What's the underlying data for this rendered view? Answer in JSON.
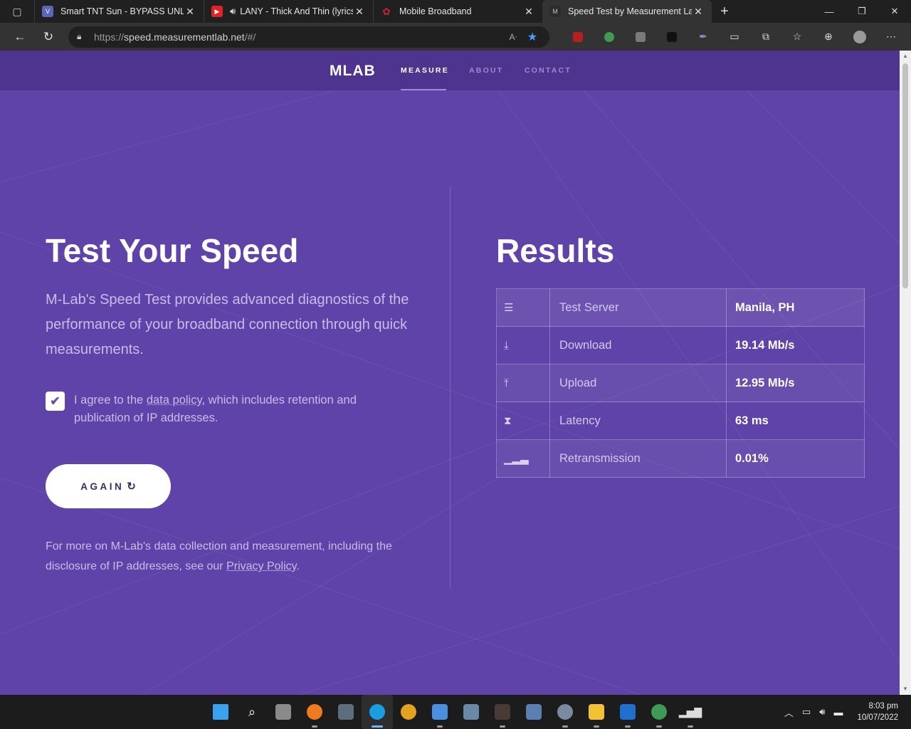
{
  "browser": {
    "tabs": [
      {
        "title": "Smart TNT Sun - BYPASS UNLIDATA",
        "fav": "V",
        "fav_color": "#5a66b8",
        "active": false,
        "muted_icon": false
      },
      {
        "title": "LANY - Thick And Thin (lyrics)",
        "fav": "▶",
        "fav_color": "#e02424",
        "active": false,
        "muted_icon": true
      },
      {
        "title": "Mobile Broadband",
        "fav": "✿",
        "fav_color": "#c0262d",
        "active": false,
        "muted_icon": false
      },
      {
        "title": "Speed Test by Measurement Lab",
        "fav": "M",
        "fav_color": "#2c2c2c",
        "active": true,
        "muted_icon": false
      }
    ],
    "url_scheme": "https://",
    "url_host": "speed.measurementlab.net",
    "url_path": "/#/"
  },
  "site": {
    "logo": "MLAB",
    "nav": [
      {
        "label": "MEASURE",
        "active": true
      },
      {
        "label": "ABOUT",
        "active": false
      },
      {
        "label": "CONTACT",
        "active": false
      }
    ]
  },
  "test": {
    "title": "Test Your Speed",
    "description": "M-Lab's Speed Test provides advanced diagnostics of the performance of your broadband connection through quick measurements.",
    "agree_prefix": "I agree to the ",
    "agree_link": "data policy",
    "agree_suffix": ", which includes retention and publication of IP addresses.",
    "agree_checked": true,
    "again_label": "AGAIN",
    "footnote_prefix": "For more on M-Lab's data collection and measurement, including the disclosure of IP addresses, see our ",
    "footnote_link": "Privacy Policy",
    "footnote_suffix": "."
  },
  "results": {
    "title": "Results",
    "rows": [
      {
        "icon": "server-icon",
        "label": "Test Server",
        "value": "Manila, PH"
      },
      {
        "icon": "download-icon",
        "label": "Download",
        "value": "19.14 Mb/s"
      },
      {
        "icon": "upload-icon",
        "label": "Upload",
        "value": "12.95 Mb/s"
      },
      {
        "icon": "hourglass-icon",
        "label": "Latency",
        "value": "63 ms"
      },
      {
        "icon": "signal-icon",
        "label": "Retransmission",
        "value": "0.01%"
      }
    ]
  },
  "taskbar": {
    "time": "8:03 pm",
    "date": "10/07/2022"
  },
  "colors": {
    "page_bg": "#5f43a8",
    "nav_bg": "#4e338f",
    "accent_star": "#4a9df8"
  }
}
